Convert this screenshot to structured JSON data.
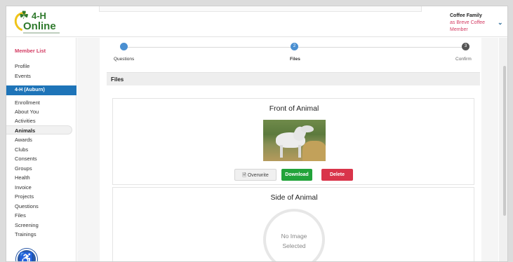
{
  "header": {
    "logo_top": "4-H",
    "logo_bottom": "Online",
    "user_name": "Coffee Family",
    "user_role_line1": "as Breve Coffee",
    "user_role_line2": "Member",
    "chevron": "⌄"
  },
  "sidebar": {
    "member_list": "Member List",
    "profile": "Profile",
    "events": "Events",
    "club": "4-H (Auburn)",
    "items": [
      "Enrollment",
      "About You",
      "Activities",
      "Animals",
      "Awards",
      "Clubs",
      "Consents",
      "Groups",
      "Health",
      "Invoice",
      "Projects",
      "Questions",
      "Files",
      "Screening",
      "Trainings"
    ],
    "active_item": "Animals"
  },
  "stepper": {
    "steps": [
      {
        "number": "1",
        "label": "Questions"
      },
      {
        "number": "2",
        "label": "Files"
      },
      {
        "number": "3",
        "label": "Confirm"
      }
    ],
    "current": "Files"
  },
  "section": {
    "title": "Files"
  },
  "cards": [
    {
      "title": "Front of Animal",
      "buttons": {
        "overwrite": "Overwrite",
        "download": "Download",
        "delete": "Delete"
      }
    },
    {
      "title": "Side of Animal",
      "placeholder_line1": "No Image",
      "placeholder_line2": "Selected"
    }
  ],
  "colors": {
    "brand_green": "#2f7a2d",
    "accent_blue": "#1e74b8",
    "member_pink": "#d33c63",
    "download_green": "#22a33a",
    "delete_red": "#d9344a"
  }
}
